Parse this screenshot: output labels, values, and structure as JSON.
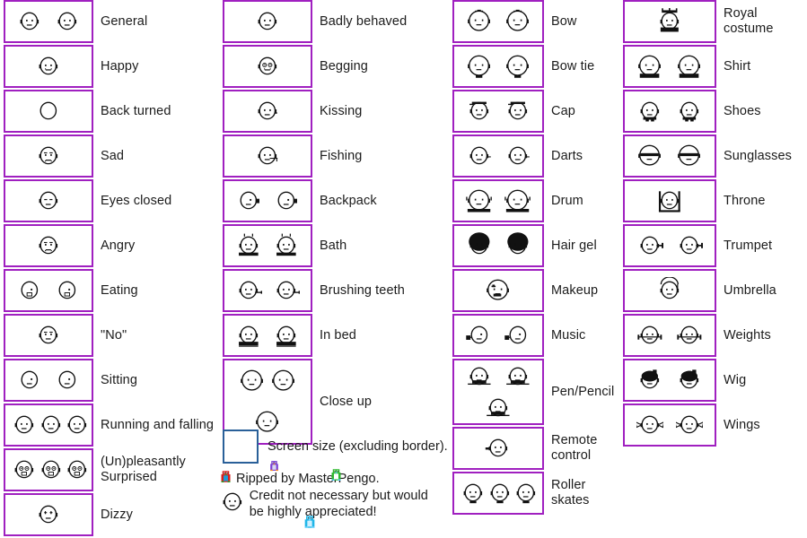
{
  "sheet": {
    "title": "Sprite sheet — character expressions and accessories",
    "border_color": "#a020c0",
    "screen_box_color": "#2a6099",
    "background": "#ffffff"
  },
  "columns": [
    {
      "id": "column-1",
      "entries": [
        {
          "label": "General",
          "frames": 2
        },
        {
          "label": "Happy",
          "frames": 1
        },
        {
          "label": "Back turned",
          "frames": 1
        },
        {
          "label": "Sad",
          "frames": 1
        },
        {
          "label": "Eyes closed",
          "frames": 1
        },
        {
          "label": "Angry",
          "frames": 1
        },
        {
          "label": "Eating",
          "frames": 2
        },
        {
          "label": "\"No\"",
          "frames": 1
        },
        {
          "label": "Sitting",
          "frames": 2
        },
        {
          "label": "Running and falling",
          "frames": 3
        },
        {
          "label": "(Un)pleasantly Surprised",
          "frames": 3
        },
        {
          "label": "Dizzy",
          "frames": 1
        }
      ]
    },
    {
      "id": "column-2",
      "entries": [
        {
          "label": "Badly behaved",
          "frames": 1
        },
        {
          "label": "Begging",
          "frames": 1
        },
        {
          "label": "Kissing",
          "frames": 1
        },
        {
          "label": "Fishing",
          "frames": 1
        },
        {
          "label": "Backpack",
          "frames": 2
        },
        {
          "label": "Bath",
          "frames": 2
        },
        {
          "label": "Brushing teeth",
          "frames": 2
        },
        {
          "label": "In bed",
          "frames": 2
        },
        {
          "label": "Close up",
          "frames": 3
        }
      ]
    },
    {
      "id": "column-3",
      "entries": [
        {
          "label": "Bow",
          "frames": 2
        },
        {
          "label": "Bow tie",
          "frames": 2
        },
        {
          "label": "Cap",
          "frames": 2
        },
        {
          "label": "Darts",
          "frames": 2
        },
        {
          "label": "Drum",
          "frames": 2
        },
        {
          "label": "Hair gel",
          "frames": 2
        },
        {
          "label": "Makeup",
          "frames": 1
        },
        {
          "label": "Music",
          "frames": 2
        },
        {
          "label": "Pen/Pencil",
          "frames": 3
        },
        {
          "label": "Remote control",
          "frames": 1
        },
        {
          "label": "Roller skates",
          "frames": 3
        }
      ]
    },
    {
      "id": "column-4",
      "entries": [
        {
          "label": "Royal costume",
          "frames": 1
        },
        {
          "label": "Shirt",
          "frames": 2
        },
        {
          "label": "Shoes",
          "frames": 2
        },
        {
          "label": "Sunglasses",
          "frames": 2
        },
        {
          "label": "Throne",
          "frames": 1
        },
        {
          "label": "Trumpet",
          "frames": 2
        },
        {
          "label": "Umbrella",
          "frames": 1
        },
        {
          "label": "Weights",
          "frames": 2
        },
        {
          "label": "Wig",
          "frames": 2
        },
        {
          "label": "Wings",
          "frames": 2
        }
      ]
    }
  ],
  "screen_note": {
    "label": "Screen size (excluding border)."
  },
  "credits": {
    "line1": "Ripped by MasterPengo.",
    "line2": "Credit not necessary but would",
    "line3": "be highly appreciated!"
  }
}
